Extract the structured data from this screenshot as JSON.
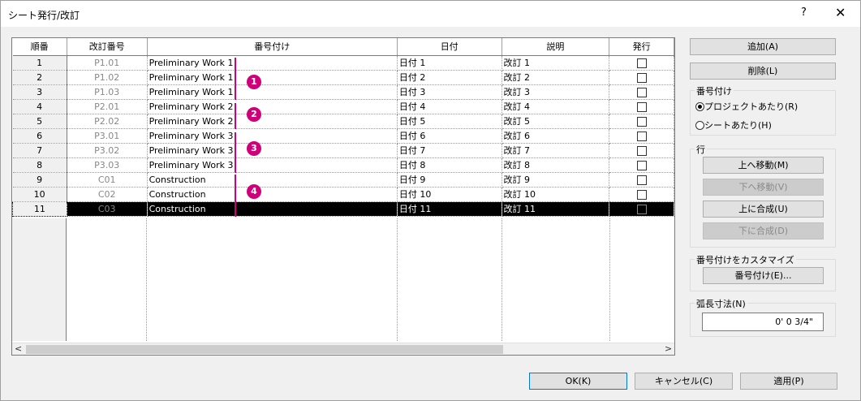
{
  "window": {
    "title": "シート発行/改訂",
    "help": "?",
    "close": "✕"
  },
  "columns": [
    "順番",
    "改訂番号",
    "番号付け",
    "日付",
    "説明",
    "発行"
  ],
  "rows": [
    {
      "seq": "1",
      "rev": "P1.01",
      "numbering": "Preliminary Work 1",
      "date": "日付 1",
      "desc": "改訂 1",
      "issued": false
    },
    {
      "seq": "2",
      "rev": "P1.02",
      "numbering": "Preliminary Work 1",
      "date": "日付 2",
      "desc": "改訂 2",
      "issued": false
    },
    {
      "seq": "3",
      "rev": "P1.03",
      "numbering": "Preliminary Work 1",
      "date": "日付 3",
      "desc": "改訂 3",
      "issued": false
    },
    {
      "seq": "4",
      "rev": "P2.01",
      "numbering": "Preliminary Work 2",
      "date": "日付 4",
      "desc": "改訂 4",
      "issued": false
    },
    {
      "seq": "5",
      "rev": "P2.02",
      "numbering": "Preliminary Work 2",
      "date": "日付 5",
      "desc": "改訂 5",
      "issued": false
    },
    {
      "seq": "6",
      "rev": "P3.01",
      "numbering": "Preliminary Work 3",
      "date": "日付 6",
      "desc": "改訂 6",
      "issued": false
    },
    {
      "seq": "7",
      "rev": "P3.02",
      "numbering": "Preliminary Work 3",
      "date": "日付 7",
      "desc": "改訂 7",
      "issued": false
    },
    {
      "seq": "8",
      "rev": "P3.03",
      "numbering": "Preliminary Work 3",
      "date": "日付 8",
      "desc": "改訂 8",
      "issued": false
    },
    {
      "seq": "9",
      "rev": "C01",
      "numbering": "Construction",
      "date": "日付 9",
      "desc": "改訂 9",
      "issued": false
    },
    {
      "seq": "10",
      "rev": "C02",
      "numbering": "Construction",
      "date": "日付 10",
      "desc": "改訂 10",
      "issued": false
    },
    {
      "seq": "11",
      "rev": "C03",
      "numbering": "Construction",
      "date": "日付 11",
      "desc": "改訂 11",
      "issued": false,
      "selected": true
    }
  ],
  "badges": [
    "1",
    "2",
    "3",
    "4"
  ],
  "scroll": {
    "left": "<",
    "right": ">"
  },
  "buttons": {
    "add": "追加(A)",
    "delete": "削除(L)",
    "move_up": "上へ移動(M)",
    "move_down": "下へ移動(V)",
    "merge_up": "上に合成(U)",
    "merge_down": "下に合成(D)",
    "customize": "番号付け(E)...",
    "ok": "OK(K)",
    "cancel": "キャンセル(C)",
    "apply": "適用(P)"
  },
  "numbering_group": {
    "title": "番号付け",
    "options": [
      "プロジェクトあたり(R)",
      "シートあたり(H)"
    ],
    "selected": 0
  },
  "row_group": {
    "title": "行"
  },
  "customize_group": {
    "title": "番号付けをカスタマイズ"
  },
  "arc_group": {
    "title": "弧長寸法(N)",
    "value": "0'  0 3/4\""
  },
  "colors": {
    "marker": "#d0007a",
    "selected_row": "#000000"
  }
}
